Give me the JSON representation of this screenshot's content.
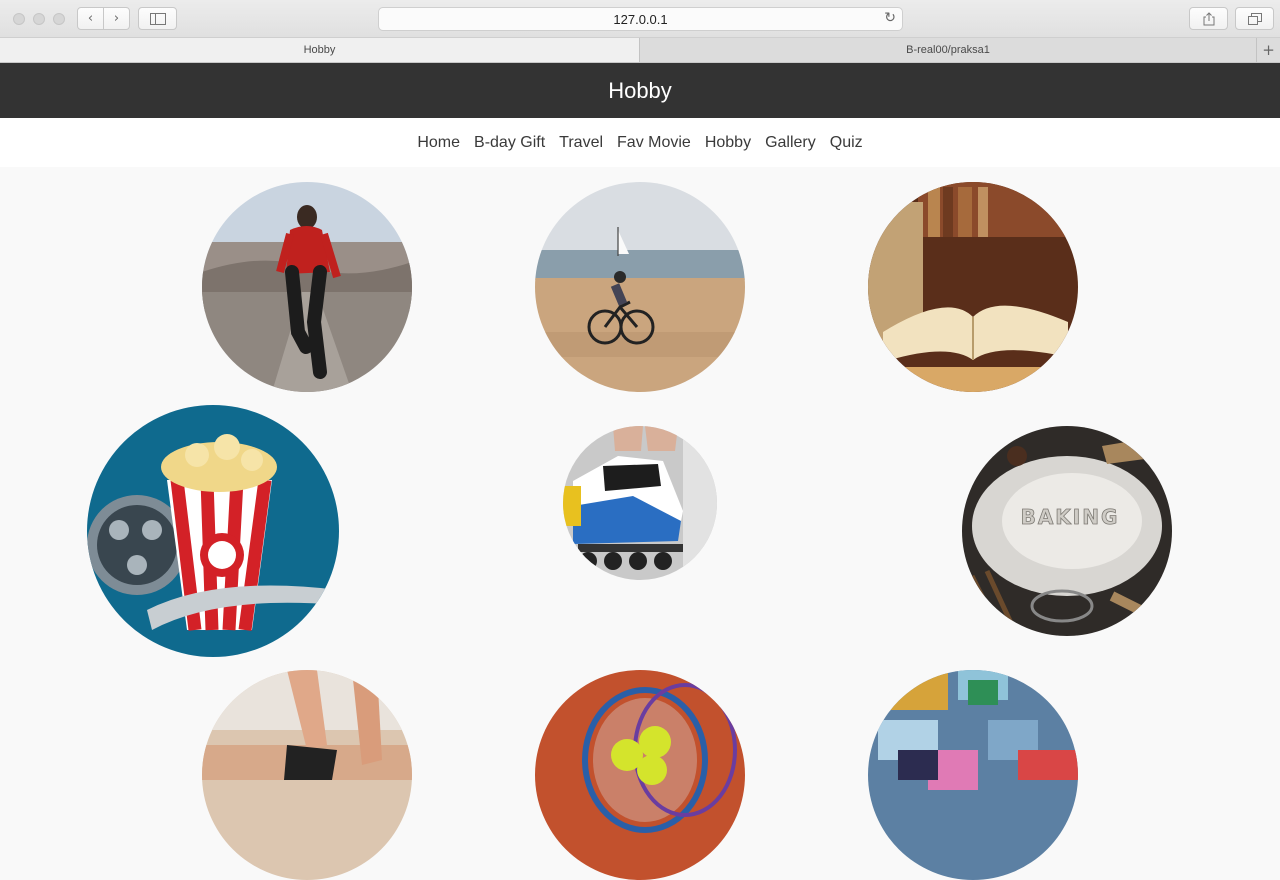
{
  "browser": {
    "url": "127.0.0.1",
    "tabs": [
      {
        "label": "Hobby",
        "active": true
      },
      {
        "label": "B-real00/praksa1",
        "active": false
      }
    ]
  },
  "page": {
    "title": "Hobby",
    "nav": [
      "Home",
      "B-day Gift",
      "Travel",
      "Fav Movie",
      "Hobby",
      "Gallery",
      "Quiz"
    ]
  },
  "gallery": [
    {
      "name": "running",
      "text": ""
    },
    {
      "name": "cycling",
      "text": ""
    },
    {
      "name": "reading",
      "text": ""
    },
    {
      "name": "movies",
      "text": ""
    },
    {
      "name": "rollerblading",
      "text": ""
    },
    {
      "name": "baking",
      "text": "BAKING"
    },
    {
      "name": "walking",
      "text": ""
    },
    {
      "name": "tennis",
      "text": ""
    },
    {
      "name": "puzzles",
      "text": ""
    }
  ],
  "colors": {
    "header_bg": "#333333",
    "nav_bg": "#ffffff",
    "page_bg": "#f9f9f9"
  }
}
